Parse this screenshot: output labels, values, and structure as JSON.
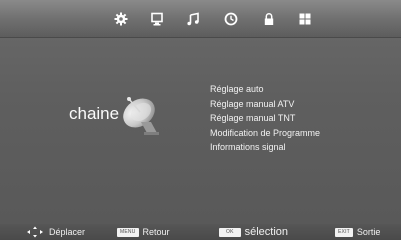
{
  "topbar": {
    "icons": [
      "gear-icon",
      "monitor-icon",
      "music-note-icon",
      "clock-icon",
      "lock-icon",
      "grid-icon"
    ],
    "active_icon": "gear-icon"
  },
  "section": {
    "label": "chaine",
    "icon": "satellite-dish-icon"
  },
  "menu": {
    "items": [
      {
        "label": "Réglage  auto"
      },
      {
        "label": "Réglage manual  ATV"
      },
      {
        "label": "Réglage manual  TNT"
      },
      {
        "label": "Modification de Programme"
      },
      {
        "label": "Informations signal"
      }
    ]
  },
  "help": {
    "move_label": "Déplacer",
    "menu_key": "MENU",
    "back_label": "Retour",
    "ok_key": "OK",
    "select_label": "sélection",
    "exit_key": "EXIT",
    "exit_label": "Sortie"
  },
  "colors": {
    "background": "#5e5e5e",
    "text": "#ffffff",
    "bottom_bar": "#4f4f4f"
  }
}
